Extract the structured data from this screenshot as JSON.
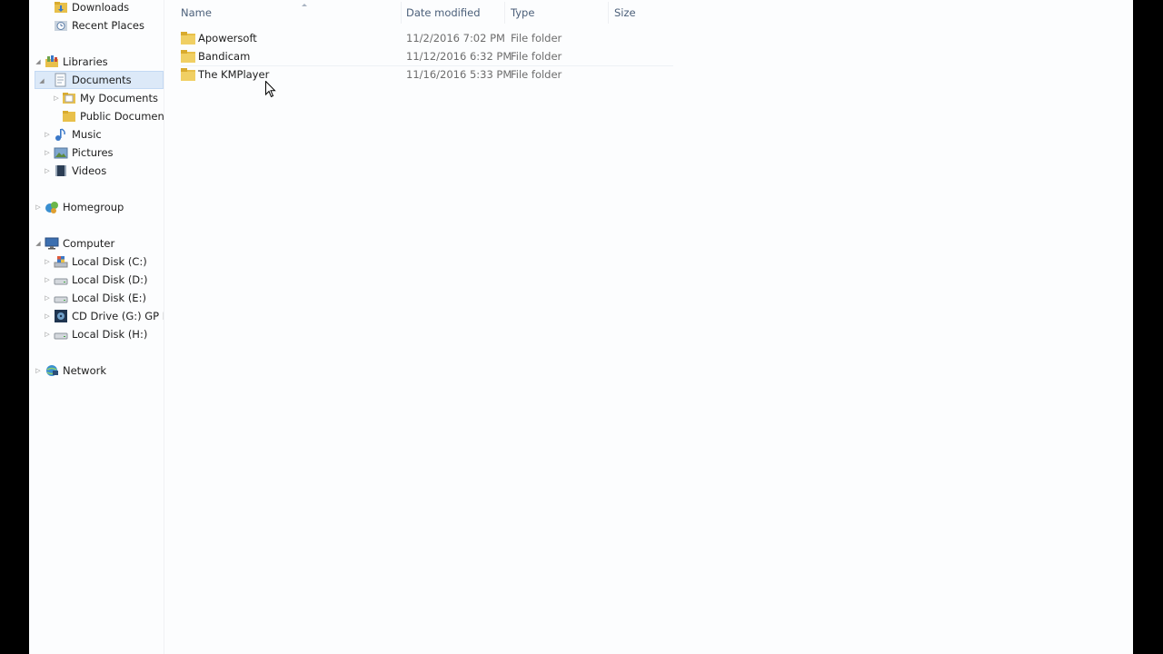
{
  "navigation": {
    "items": [
      {
        "label": "Downloads",
        "icon": "folder-downloads-icon"
      },
      {
        "label": "Recent Places",
        "icon": "recent-places-icon"
      },
      {
        "label": "Libraries",
        "icon": "libraries-icon",
        "expanded": true
      },
      {
        "label": "Documents",
        "icon": "documents-library-icon",
        "expanded": true,
        "selected": true
      },
      {
        "label": "My Documents",
        "icon": "folder-icon"
      },
      {
        "label": "Public Documents",
        "icon": "folder-icon"
      },
      {
        "label": "Music",
        "icon": "music-icon"
      },
      {
        "label": "Pictures",
        "icon": "pictures-icon"
      },
      {
        "label": "Videos",
        "icon": "videos-icon"
      },
      {
        "label": "Homegroup",
        "icon": "homegroup-icon"
      },
      {
        "label": "Computer",
        "icon": "computer-icon",
        "expanded": true
      },
      {
        "label": "Local Disk (C:)",
        "icon": "system-drive-icon"
      },
      {
        "label": "Local Disk (D:)",
        "icon": "drive-icon"
      },
      {
        "label": "Local Disk (E:)",
        "icon": "drive-icon"
      },
      {
        "label": "CD Drive (G:) GP Inte",
        "icon": "cd-drive-icon"
      },
      {
        "label": "Local Disk (H:)",
        "icon": "drive-icon"
      },
      {
        "label": "Network",
        "icon": "network-icon"
      }
    ]
  },
  "file_list": {
    "columns": {
      "name": "Name",
      "date": "Date modified",
      "type": "Type",
      "size": "Size"
    },
    "sort_column": "Name",
    "rows": [
      {
        "name": "Apowersoft",
        "date": "11/2/2016 7:02 PM",
        "type": "File folder",
        "size": "",
        "icon": "folder-icon"
      },
      {
        "name": "Bandicam",
        "date": "11/12/2016 6:32 PM",
        "type": "File folder",
        "size": "",
        "icon": "folder-icon"
      },
      {
        "name": "The KMPlayer",
        "date": "11/16/2016 5:33 PM",
        "type": "File folder",
        "size": "",
        "icon": "folder-icon"
      }
    ]
  },
  "colors": {
    "selection": "#dce9f8",
    "header_text": "#4c607a",
    "folder": "#e8c04a"
  }
}
